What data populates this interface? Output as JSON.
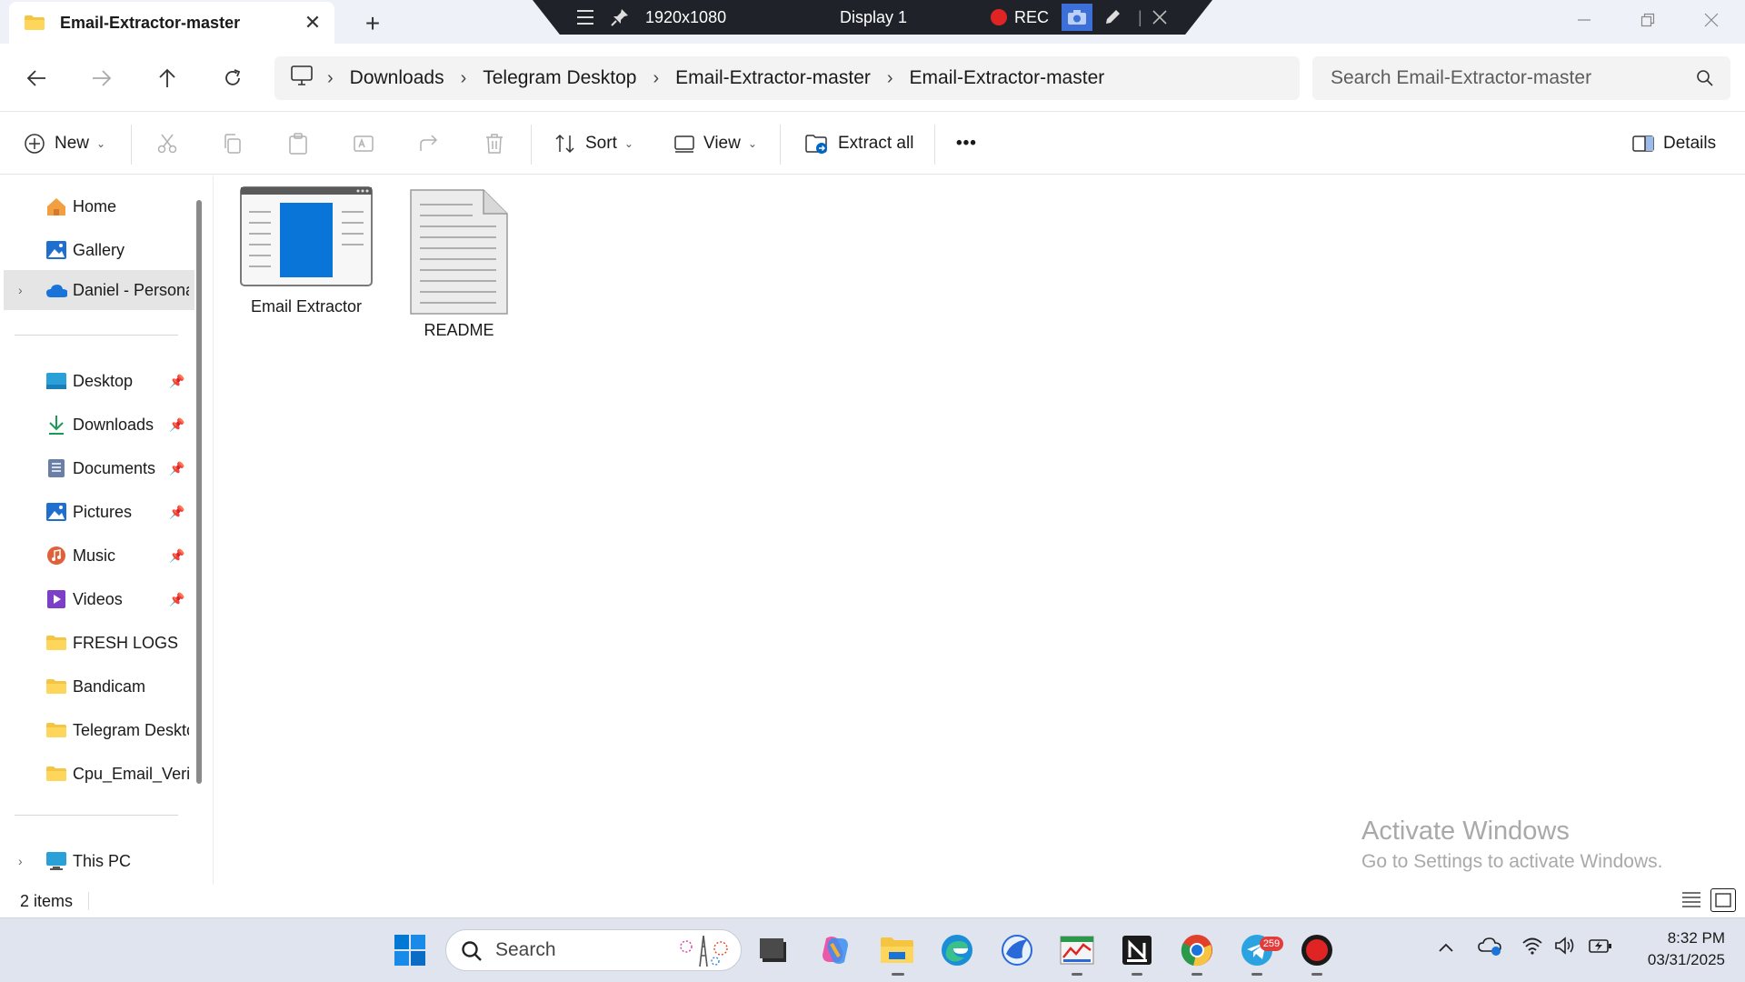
{
  "window": {
    "tab_title": "Email-Extractor-master",
    "new_tab_symbol": "+",
    "close_symbol": "✕"
  },
  "recorder": {
    "resolution": "1920x1080",
    "display": "Display 1",
    "rec_label": "REC"
  },
  "address": {
    "crumbs": [
      "Downloads",
      "Telegram Desktop",
      "Email-Extractor-master",
      "Email-Extractor-master"
    ],
    "search_placeholder": "Search Email-Extractor-master"
  },
  "commands": {
    "new_label": "New",
    "sort_label": "Sort",
    "view_label": "View",
    "extract_label": "Extract all",
    "details_label": "Details",
    "more_label": "•••"
  },
  "sidebar": {
    "top_items": [
      {
        "label": "Home",
        "icon": "home-icon"
      },
      {
        "label": "Gallery",
        "icon": "gallery-icon"
      },
      {
        "label": "Daniel - Persona",
        "icon": "onedrive-cloud-icon"
      }
    ],
    "quick_access": [
      {
        "label": "Desktop",
        "icon": "desktop-icon",
        "pinned": true
      },
      {
        "label": "Downloads",
        "icon": "download-icon",
        "pinned": true
      },
      {
        "label": "Documents",
        "icon": "documents-icon",
        "pinned": true
      },
      {
        "label": "Pictures",
        "icon": "pictures-icon",
        "pinned": true
      },
      {
        "label": "Music",
        "icon": "music-icon",
        "pinned": true
      },
      {
        "label": "Videos",
        "icon": "videos-icon",
        "pinned": true
      },
      {
        "label": "FRESH LOGS",
        "icon": "folder-icon",
        "pinned": false
      },
      {
        "label": "Bandicam",
        "icon": "folder-icon",
        "pinned": false
      },
      {
        "label": "Telegram Desktc",
        "icon": "folder-icon",
        "pinned": false
      },
      {
        "label": "Cpu_Email_Verifi",
        "icon": "folder-icon",
        "pinned": false
      }
    ],
    "this_pc": "This PC"
  },
  "files": [
    {
      "name": "Email Extractor",
      "icon": "application-window-icon"
    },
    {
      "name": "README",
      "icon": "text-document-icon"
    }
  ],
  "watermark": {
    "line1": "Activate Windows",
    "line2": "Go to Settings to activate Windows."
  },
  "status": {
    "item_count": "2 items"
  },
  "taskbar": {
    "search_label": "Search",
    "telegram_badge": "259",
    "time": "8:32 PM",
    "date": "03/31/2025"
  },
  "colors": {
    "accent": "#0067c0",
    "folder_yellow": "#f5c542",
    "titlebar_bg": "#eef1f8",
    "taskbar_bg": "#dfe4ee",
    "rec_red": "#e02424"
  }
}
